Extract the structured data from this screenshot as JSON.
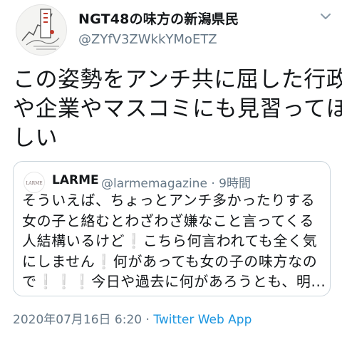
{
  "author": {
    "display_name": "NGT48の味方の新潟県民",
    "handle": "@ZYfV3ZWkkYMoETZ"
  },
  "tweet": {
    "text_lines": [
      "この姿勢をアンチ共に屈した行政",
      "や企業やマスコミにも見習ってほ",
      "しい"
    ]
  },
  "quoted_tweet": {
    "avatar_text": "LARME",
    "name": "LARME",
    "handle_time": "@larmemagazine · 9時間",
    "text_lines": [
      "そういえば、ちょっとアンチ多かったりする",
      "女の子と絡むとわざわざ嫌なこと言ってくる",
      "人結構いるけど❕こちら何言われても全く気",
      "にしません❕何があっても女の子の味方なの",
      "で❕❕❕今日や過去に何があろうとも、明..."
    ]
  },
  "meta": {
    "timestamp": "2020年07月16日 6:20 · ",
    "app": "Twitter Web App"
  },
  "colors": {
    "secondary_text": "#657786",
    "link": "#1b95e0",
    "border": "#ccd6dd"
  },
  "icons": {
    "menu": "chevron-down-icon"
  }
}
